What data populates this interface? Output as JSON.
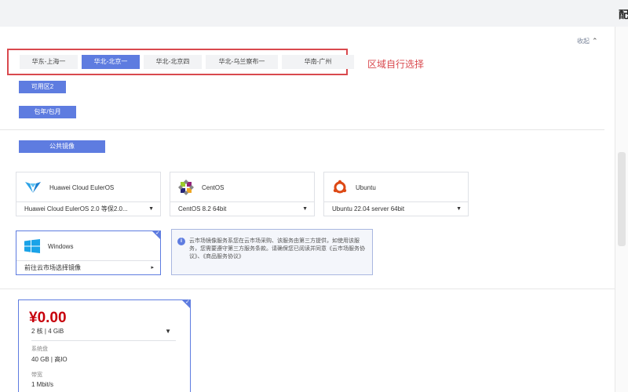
{
  "page_title_fragment": "配",
  "collapse_label": "收起",
  "regions": [
    "华东-上海一",
    "华北-北京一",
    "华北-北京四",
    "华北-乌兰察布一",
    "华南-广州"
  ],
  "active_region_index": 1,
  "region_hint": "区域自行选择",
  "availability_zone": "可用区2",
  "billing_mode": "包年/包月",
  "image_type": "公共镜像",
  "os_cards": [
    {
      "name": "Huawei Cloud EulerOS",
      "icon": "euleros-logo-icon",
      "version": "Huawei Cloud EulerOS 2.0 等保2.0..."
    },
    {
      "name": "CentOS",
      "icon": "centos-logo-icon",
      "version": "CentOS 8.2 64bit"
    },
    {
      "name": "Ubuntu",
      "icon": "ubuntu-logo-icon",
      "version": "Ubuntu 22.04 server 64bit"
    }
  ],
  "windows_card": {
    "name": "Windows",
    "icon": "windows-logo-icon",
    "action": "前往云市场选择镜像"
  },
  "notice_text": "云市场镜像服务系您在云市场采购、该服务由第三方提供，如使用该服务，您需要遵守第三方服务条款。请确保您已阅读并同意《云市场服务协议》、《商品服务协议》",
  "price_card": {
    "price": "¥0.00",
    "spec": "2 核 | 4 GiB",
    "disk_label": "系统盘",
    "disk_value": "40 GB | 高IO",
    "bandwidth_label": "带宽",
    "bandwidth_value": "1 Mbit/s"
  },
  "colors": {
    "accent": "#5e7ce0",
    "highlight_red": "#d9494e",
    "price_red": "#c7000b"
  }
}
